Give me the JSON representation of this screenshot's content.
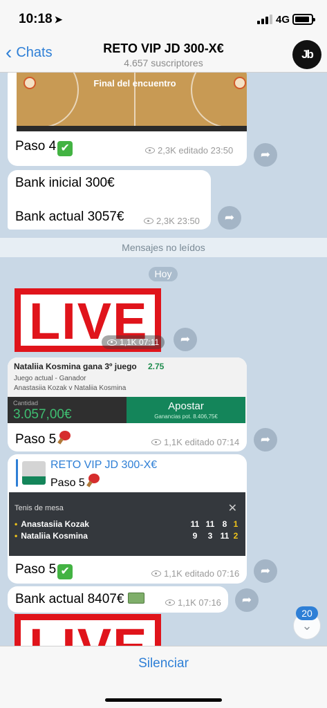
{
  "status_bar": {
    "time": "10:18",
    "network": "4G"
  },
  "nav": {
    "back_label": "Chats",
    "title": "RETO VIP JD 300-X€",
    "subtitle": "4.657 suscriptores",
    "avatar_text": "Jb"
  },
  "messages": {
    "m1": {
      "image_caption": "Final del encuentro",
      "text": "Paso 4",
      "views": "2,3K",
      "time": "editado 23:50"
    },
    "m2": {
      "line1": "Bank inicial 300€",
      "line2": "Bank actual 3057€",
      "views": "2,3K",
      "time": "23:50"
    },
    "unread_label": "Mensajes no leídos",
    "date_label": "Hoy",
    "m3": {
      "image_text": "LIVE",
      "views": "1,1K",
      "time": "07:11"
    },
    "m4": {
      "bet_title": "Nataliia Kosmina gana 3º juego",
      "bet_odds": "2.75",
      "bet_market": "Juego actual - Ganador",
      "bet_event": "Anastasiia Kozak v Nataliia Kosmina",
      "stake_label": "Cantidad",
      "stake_value": "3.057,00€",
      "button_label": "Apostar",
      "button_sub": "Ganancias pot. 8.406,75€",
      "text": "Paso 5",
      "views": "1,1K",
      "time": "editado 07:14"
    },
    "m5": {
      "reply_title": "RETO VIP JD 300-X€",
      "reply_text": "Paso 5",
      "score_header": "Tenis de mesa",
      "player1": "Anastasiia Kozak",
      "player2": "Nataliia Kosmina",
      "p1_scores": [
        "11",
        "11",
        "8",
        "1"
      ],
      "p2_scores": [
        "9",
        "3",
        "11",
        "2"
      ],
      "text": "Paso 5",
      "views": "1,1K",
      "time": "editado 07:16"
    },
    "m6": {
      "text": "Bank actual 8407€",
      "views": "1,1K",
      "time": "07:16"
    },
    "m7": {
      "image_text": "LIVE"
    }
  },
  "unread_badge": "20",
  "bottom": {
    "mute_label": "Silenciar"
  },
  "colors": {
    "accent": "#2e7fd6",
    "live_red": "#e0141b",
    "bet_green": "#14855a"
  },
  "icons": [
    "location-arrow-icon",
    "signal-icon",
    "battery-icon",
    "chevron-left-icon",
    "eye-icon",
    "share-icon",
    "checkmark-icon",
    "ping-pong-paddle-icon",
    "money-icon",
    "chevron-down-icon",
    "close-icon"
  ]
}
